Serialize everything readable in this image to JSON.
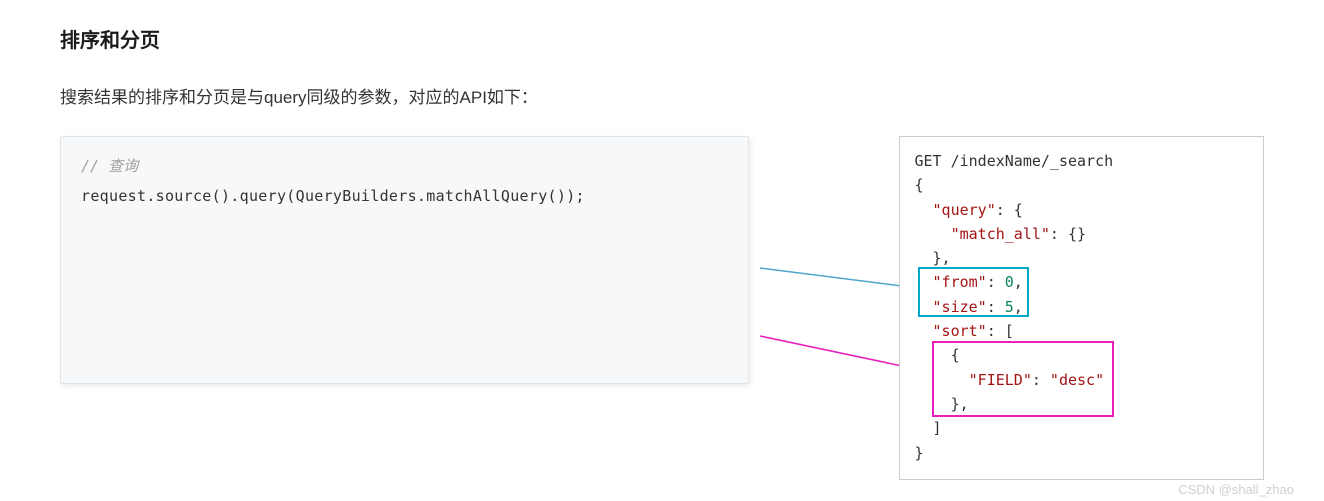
{
  "heading": "排序和分页",
  "description": "搜索结果的排序和分页是与query同级的参数，对应的API如下：",
  "leftCode": {
    "comment": "//  查询",
    "line": "request.source().query(QueryBuilders.matchAllQuery());"
  },
  "rightCode": {
    "line1_a": "GET /indexName/_search",
    "brace_open": "{",
    "query_key": "\"query\"",
    "query_colon": ": {",
    "match_all_key": "\"match_all\"",
    "match_all_val": ": {}",
    "close1": "},",
    "from_key": "\"from\"",
    "from_colon": ": ",
    "from_val": "0",
    "comma1": ",",
    "size_key": "\"size\"",
    "size_colon": ": ",
    "size_val": "5",
    "comma2": ",",
    "sort_key": "\"sort\"",
    "sort_colon": ": [",
    "brace_open2": "{",
    "field_key": "\"FIELD\"",
    "field_colon": ": ",
    "field_val": "\"desc\"",
    "close2": "},",
    "bracket_close": "]",
    "brace_close": "}"
  },
  "watermark": "CSDN @shall_zhao"
}
